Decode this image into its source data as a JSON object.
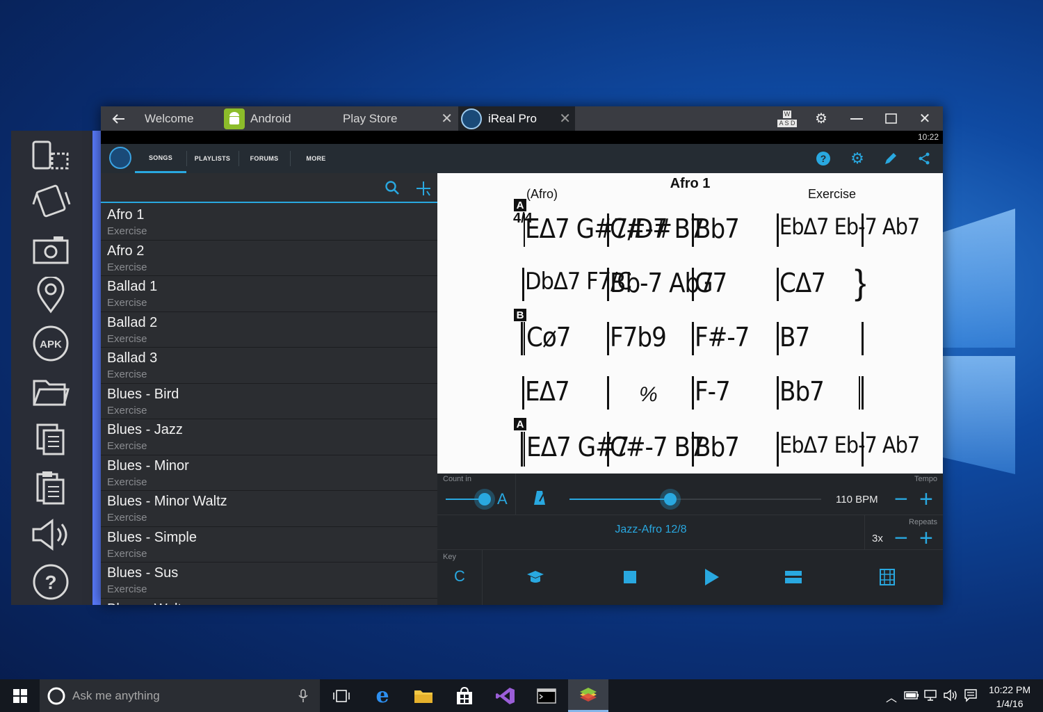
{
  "tabs": {
    "welcome": "Welcome",
    "android": "Android",
    "playstore": "Play Store",
    "ireal": "iReal Pro"
  },
  "window_controls": {
    "keymap_top": "W",
    "keymap_bottom": "A S D"
  },
  "status_time": "10:22",
  "app_nav": {
    "songs": "SONGS",
    "playlists": "PLAYLISTS",
    "forums": "FORUMS",
    "more": "MORE"
  },
  "song_list": [
    {
      "title": "Afro 1",
      "sub": "Exercise"
    },
    {
      "title": "Afro 2",
      "sub": "Exercise"
    },
    {
      "title": "Ballad 1",
      "sub": "Exercise"
    },
    {
      "title": "Ballad 2",
      "sub": "Exercise"
    },
    {
      "title": "Ballad 3",
      "sub": "Exercise"
    },
    {
      "title": "Blues - Bird",
      "sub": "Exercise"
    },
    {
      "title": "Blues - Jazz",
      "sub": "Exercise"
    },
    {
      "title": "Blues - Minor",
      "sub": "Exercise"
    },
    {
      "title": "Blues - Minor Waltz",
      "sub": "Exercise"
    },
    {
      "title": "Blues - Simple",
      "sub": "Exercise"
    },
    {
      "title": "Blues - Sus",
      "sub": "Exercise"
    },
    {
      "title": "Blues - Waltz",
      "sub": ""
    }
  ],
  "sheet": {
    "title": "Afro 1",
    "style": "(Afro)",
    "composer": "Exercise",
    "time_sig": "4/4",
    "sections": [
      "A",
      "B",
      "A"
    ],
    "rows": [
      [
        "EΔ7 G#7/D#",
        "C#-7 B7",
        "Bb7",
        "EbΔ7 Eb-7 Ab7"
      ],
      [
        "DbΔ7 F7/C",
        "Bb-7 Ab7",
        "G7",
        "CΔ7"
      ],
      [
        "Cø7",
        "F7b9",
        "F#-7",
        "B7"
      ],
      [
        "EΔ7",
        "%",
        "F-7",
        "Bb7"
      ],
      [
        "EΔ7 G#7",
        "C#-7 B7",
        "Bb7",
        "EbΔ7 Eb-7 Ab7"
      ]
    ]
  },
  "controls": {
    "count_in_label": "Count in",
    "count_in_value": "A",
    "tempo_label": "Tempo",
    "tempo_value": "110 BPM",
    "tempo_fraction": 0.4,
    "count_in_fraction": 0.8,
    "style_name": "Jazz-Afro 12/8",
    "repeats_label": "Repeats",
    "repeats_value": "3x",
    "key_label": "Key",
    "key_value": "C"
  },
  "taskbar": {
    "search_placeholder": "Ask me anything",
    "time": "10:22 PM",
    "date": "1/4/16"
  },
  "colors": {
    "accent": "#29a8e0",
    "bluestacks_accent": "#5a7cff"
  }
}
